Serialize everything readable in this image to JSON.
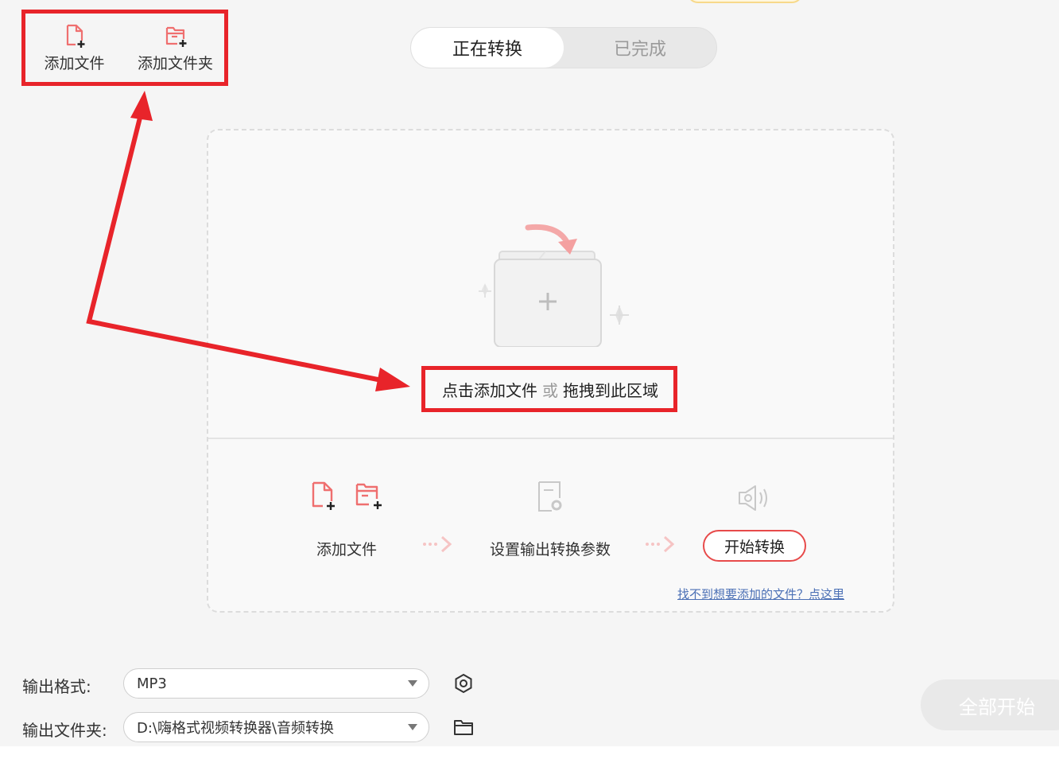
{
  "toolbar": {
    "add_file_label": "添加文件",
    "add_folder_label": "添加文件夹"
  },
  "tabs": [
    {
      "label": "正在转换",
      "active": true
    },
    {
      "label": "已完成",
      "active": false
    }
  ],
  "dropzone": {
    "prompt_part1": "点击添加文件",
    "prompt_or": "或",
    "prompt_part2": "拖拽到此区域",
    "step1_label": "添加文件",
    "step2_label": "设置输出转换参数",
    "step3_button": "开始转换",
    "help_link": "找不到想要添加的文件？点这里"
  },
  "output": {
    "format_label": "输出格式:",
    "format_value": "MP3",
    "folder_label": "输出文件夹:",
    "folder_value": "D:\\嗨格式视频转换器\\音频转换"
  },
  "start_all_label": "全部开始",
  "colors": {
    "accent_red": "#e74a4a",
    "annotation_red": "#e8242a",
    "icon_pink": "#ef6f6f"
  }
}
